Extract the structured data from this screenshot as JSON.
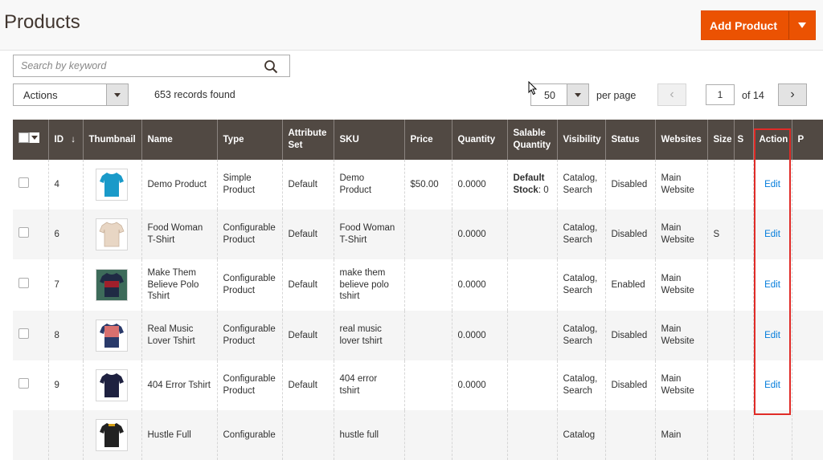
{
  "header": {
    "title": "Products",
    "add_button_label": "Add Product"
  },
  "toolbar": {
    "search_placeholder": "Search by keyword",
    "actions_label": "Actions",
    "records_text": "653 records found",
    "per_page_value": "50",
    "per_page_label": "per page",
    "current_page": "1",
    "of_pages": "of 14",
    "prev_symbol": "‹",
    "next_symbol": "›"
  },
  "table": {
    "columns": [
      "ID",
      "Thumbnail",
      "Name",
      "Type",
      "Attribute Set",
      "SKU",
      "Price",
      "Quantity",
      "Salable Quantity",
      "Visibility",
      "Status",
      "Websites",
      "Size",
      "S",
      "Action",
      "P"
    ],
    "id_sort_arrow": "↓",
    "rows": [
      {
        "id": "4",
        "name": "Demo Product",
        "type": "Simple Product",
        "attribute_set": "Default",
        "sku": "Demo Product",
        "price": "$50.00",
        "quantity": "0.0000",
        "salable_label": "Default Stock",
        "salable_value": ": 0",
        "visibility": "Catalog, Search",
        "status": "Disabled",
        "websites": "Main Website",
        "size": "",
        "action": "Edit",
        "thumb_color": "#1a9ac9",
        "thumb_accent": "#1a9ac9"
      },
      {
        "id": "6",
        "name": "Food Woman T-Shirt",
        "type": "Configurable Product",
        "attribute_set": "Default",
        "sku": "Food Woman T-Shirt",
        "price": "",
        "quantity": "0.0000",
        "salable_label": "",
        "salable_value": "",
        "visibility": "Catalog, Search",
        "status": "Disabled",
        "websites": "Main Website",
        "size": "S",
        "action": "Edit",
        "thumb_color": "#e8d6c4",
        "thumb_accent": "#e8d6c4"
      },
      {
        "id": "7",
        "name": "Make Them Believe Polo Tshirt",
        "type": "Configurable Product",
        "attribute_set": "Default",
        "sku": "make them believe polo tshirt",
        "price": "",
        "quantity": "0.0000",
        "salable_label": "",
        "salable_value": "",
        "visibility": "Catalog, Search",
        "status": "Enabled",
        "websites": "Main Website",
        "size": "",
        "action": "Edit",
        "thumb_color": "#a11f2b",
        "thumb_accent": "#1f2a44"
      },
      {
        "id": "8",
        "name": "Real Music Lover Tshirt",
        "type": "Configurable Product",
        "attribute_set": "Default",
        "sku": "real music lover tshirt",
        "price": "",
        "quantity": "0.0000",
        "salable_label": "",
        "salable_value": "",
        "visibility": "Catalog, Search",
        "status": "Disabled",
        "websites": "Main Website",
        "size": "",
        "action": "Edit",
        "thumb_color": "#d9706f",
        "thumb_accent": "#2a3a6a"
      },
      {
        "id": "9",
        "name": "404 Error Tshirt",
        "type": "Configurable Product",
        "attribute_set": "Default",
        "sku": "404 error tshirt",
        "price": "",
        "quantity": "0.0000",
        "salable_label": "",
        "salable_value": "",
        "visibility": "Catalog, Search",
        "status": "Disabled",
        "websites": "Main Website",
        "size": "",
        "action": "Edit",
        "thumb_color": "#1e2140",
        "thumb_accent": "#1e2140"
      },
      {
        "id": "",
        "name": "Hustle Full",
        "type": "Configurable",
        "attribute_set": "",
        "sku": "hustle full",
        "price": "",
        "quantity": "",
        "salable_label": "",
        "salable_value": "",
        "visibility": "Catalog",
        "status": "",
        "websites": "Main",
        "size": "",
        "action": "",
        "thumb_color": "#222222",
        "thumb_accent": "#d4a017"
      }
    ]
  },
  "colors": {
    "accent": "#eb5202",
    "header_bg": "#514943",
    "link": "#007bdb",
    "highlight": "#e02b27"
  }
}
